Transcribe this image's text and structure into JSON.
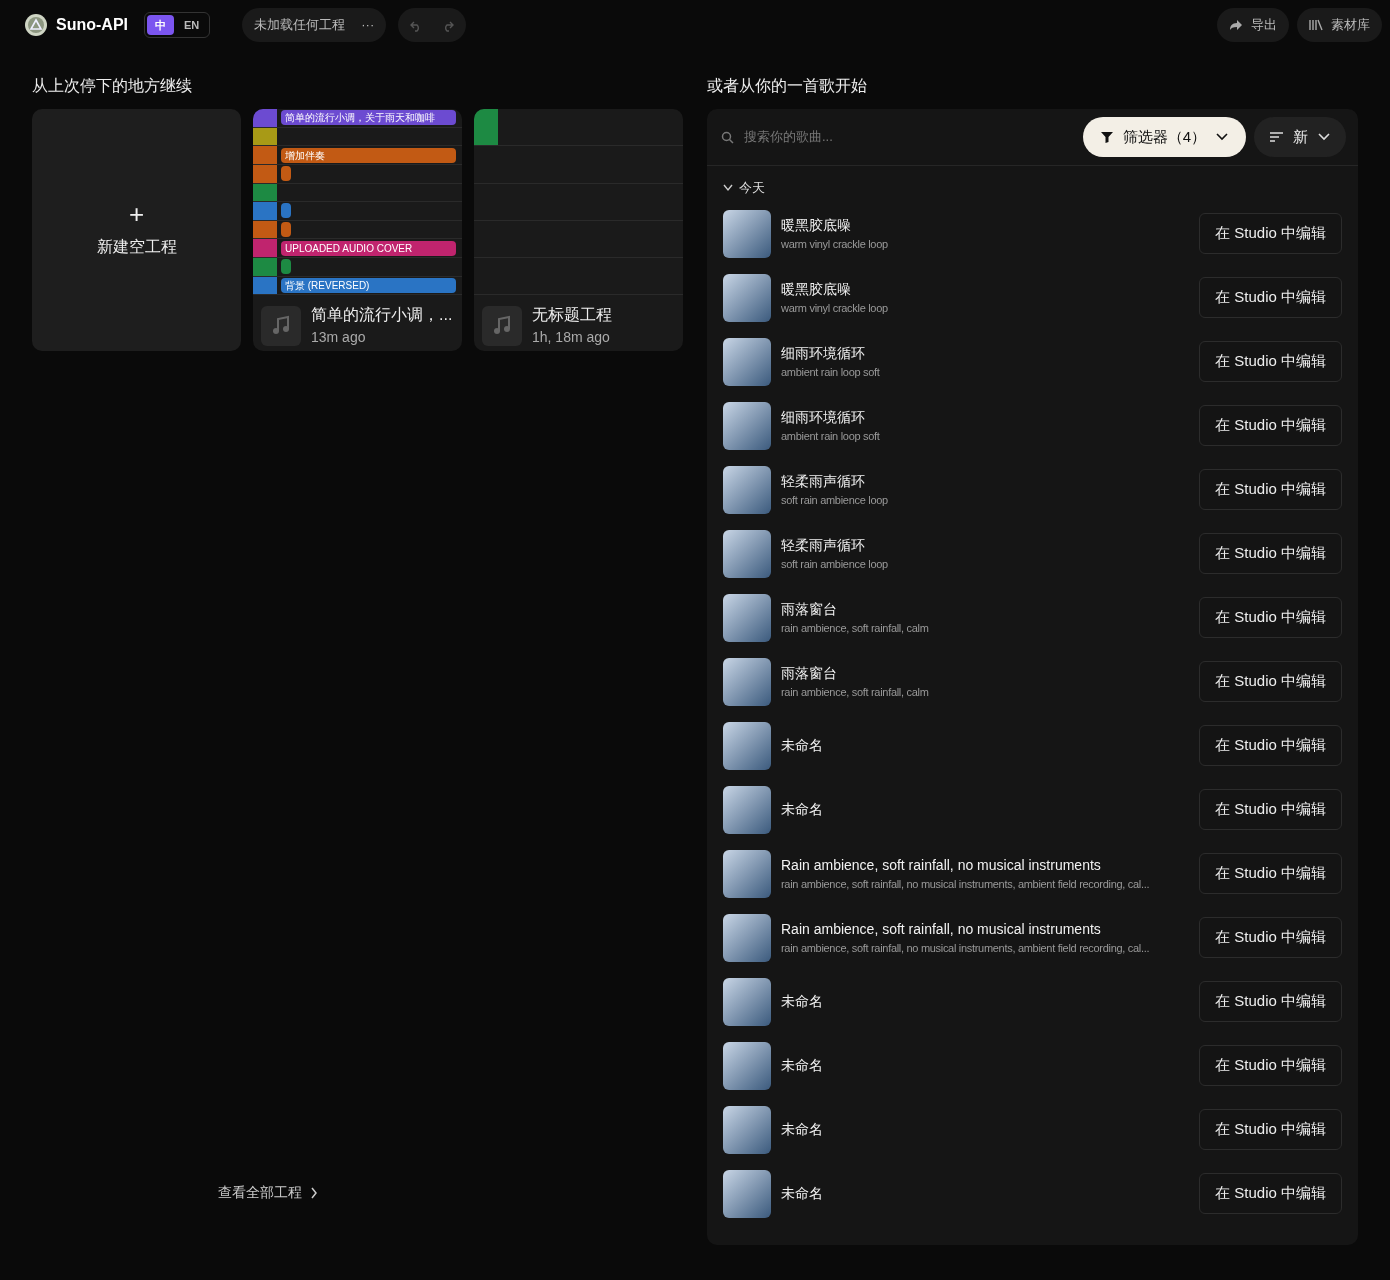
{
  "header": {
    "brand": "Suno-API",
    "languages": [
      {
        "label": "中",
        "selected": true
      },
      {
        "label": "EN",
        "selected": false
      }
    ],
    "project_label": "未加载任何工程",
    "more": "···",
    "export": "导出",
    "library": "素材库"
  },
  "left": {
    "heading": "从上次停下的地方继续",
    "new_project": {
      "plus": "+",
      "label": "新建空工程"
    },
    "projects": [
      {
        "title": "简单的流行小调，...",
        "time": "13m ago",
        "tracks": [
          {
            "color": "#6c4bd1",
            "kind": "long",
            "label": "简单的流行小调，关于雨天和咖啡"
          },
          {
            "color": "#a89a16",
            "kind": "empty"
          },
          {
            "color": "#c25a14",
            "kind": "long",
            "label": "增加伴奏"
          },
          {
            "color": "#c25a14",
            "kind": "short"
          },
          {
            "color": "#1d8a43",
            "kind": "empty"
          },
          {
            "color": "#2a74c4",
            "kind": "short"
          },
          {
            "color": "#c25a14",
            "kind": "short"
          },
          {
            "color": "#c0246e",
            "kind": "long",
            "label": "UPLOADED AUDIO COVER"
          },
          {
            "color": "#1d8a43",
            "kind": "short"
          },
          {
            "color": "#2a74c4",
            "kind": "long",
            "label": "背景 (REVERSED)"
          }
        ]
      },
      {
        "title": "无标题工程",
        "time": "1h, 18m ago",
        "tracks": [
          {
            "color": "#1d8a43",
            "kind": "empty"
          }
        ]
      }
    ],
    "view_all": "查看全部工程"
  },
  "right": {
    "heading": "或者从你的一首歌开始",
    "search": {
      "placeholder": "搜索你的歌曲..."
    },
    "filter": {
      "label": "筛选器（4）"
    },
    "sort": {
      "label": "新"
    },
    "group": {
      "label": "今天",
      "expanded": true
    },
    "songs": [
      {
        "title": "暖黑胶底噪",
        "subtitle": "warm vinyl crackle loop",
        "action": "在 Studio 中编辑"
      },
      {
        "title": "暖黑胶底噪",
        "subtitle": "warm vinyl crackle loop",
        "action": "在 Studio 中编辑"
      },
      {
        "title": "细雨环境循环",
        "subtitle": "ambient rain loop soft",
        "action": "在 Studio 中编辑"
      },
      {
        "title": "细雨环境循环",
        "subtitle": "ambient rain loop soft",
        "action": "在 Studio 中编辑"
      },
      {
        "title": "轻柔雨声循环",
        "subtitle": "soft rain ambience loop",
        "action": "在 Studio 中编辑"
      },
      {
        "title": "轻柔雨声循环",
        "subtitle": "soft rain ambience loop",
        "action": "在 Studio 中编辑"
      },
      {
        "title": "雨落窗台",
        "subtitle": "rain ambience, soft rainfall, calm",
        "action": "在 Studio 中编辑"
      },
      {
        "title": "雨落窗台",
        "subtitle": "rain ambience, soft rainfall, calm",
        "action": "在 Studio 中编辑"
      },
      {
        "title": "未命名",
        "action": "在 Studio 中编辑"
      },
      {
        "title": "未命名",
        "action": "在 Studio 中编辑"
      },
      {
        "title": "Rain ambience, soft rainfall, no musical instruments",
        "subtitle": "rain ambience, soft rainfall, no musical instruments, ambient field recording, cal...",
        "action": "在 Studio 中编辑"
      },
      {
        "title": "Rain ambience, soft rainfall, no musical instruments",
        "subtitle": "rain ambience, soft rainfall, no musical instruments, ambient field recording, cal...",
        "action": "在 Studio 中编辑"
      },
      {
        "title": "未命名",
        "action": "在 Studio 中编辑"
      },
      {
        "title": "未命名",
        "action": "在 Studio 中编辑"
      },
      {
        "title": "未命名",
        "action": "在 Studio 中编辑"
      },
      {
        "title": "未命名",
        "action": "在 Studio 中编辑"
      }
    ]
  }
}
